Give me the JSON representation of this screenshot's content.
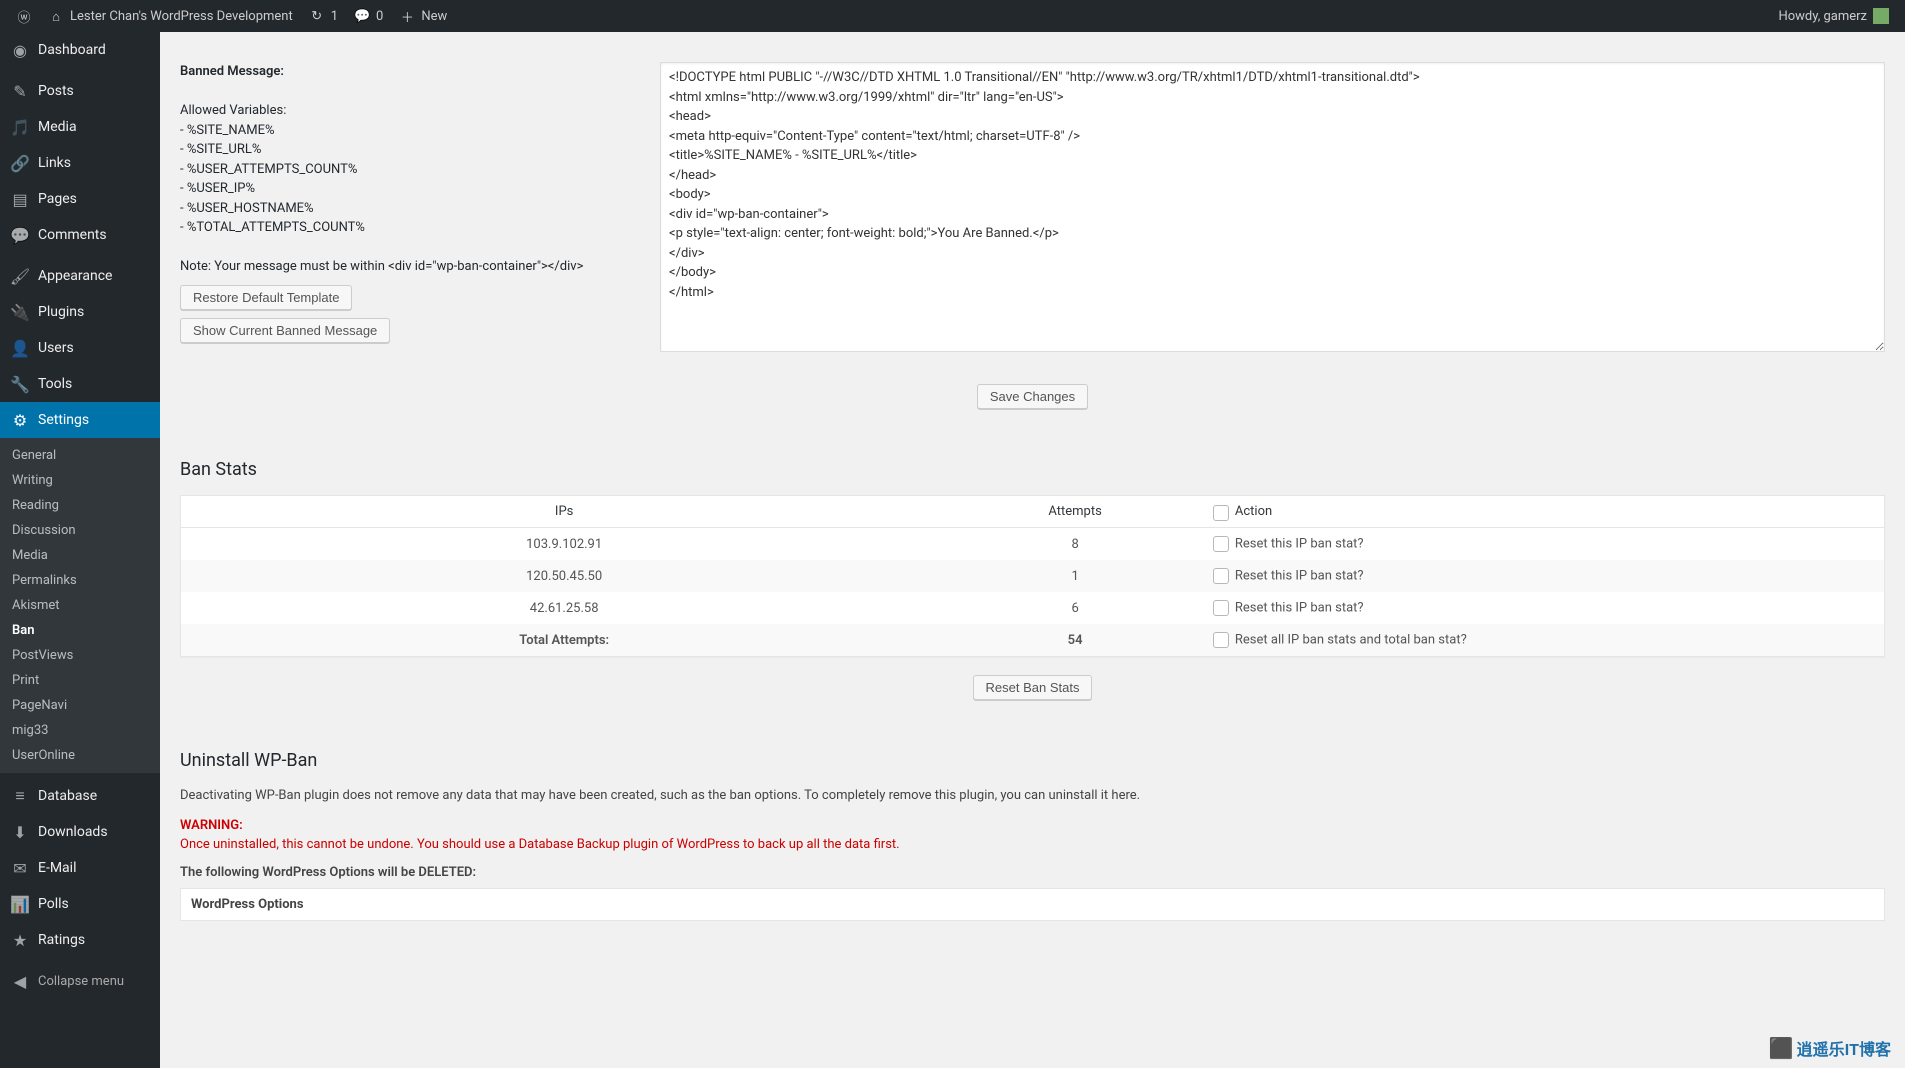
{
  "adminbar": {
    "site_name": "Lester Chan's WordPress Development",
    "updates_count": "1",
    "comments_count": "0",
    "new_label": "New",
    "howdy": "Howdy, gamerz"
  },
  "menu": {
    "dashboard": "Dashboard",
    "posts": "Posts",
    "media": "Media",
    "links": "Links",
    "pages": "Pages",
    "comments": "Comments",
    "appearance": "Appearance",
    "plugins": "Plugins",
    "users": "Users",
    "tools": "Tools",
    "settings": "Settings",
    "database": "Database",
    "downloads": "Downloads",
    "email": "E-Mail",
    "polls": "Polls",
    "ratings": "Ratings",
    "collapse": "Collapse menu"
  },
  "submenu": {
    "general": "General",
    "writing": "Writing",
    "reading": "Reading",
    "discussion": "Discussion",
    "media": "Media",
    "permalinks": "Permalinks",
    "akismet": "Akismet",
    "ban": "Ban",
    "postviews": "PostViews",
    "print": "Print",
    "pagenavi": "PageNavi",
    "mig33": "mig33",
    "useronline": "UserOnline"
  },
  "banned_message": {
    "label": "Banned Message:",
    "allowed_heading": "Allowed Variables:",
    "vars": [
      "- %SITE_NAME%",
      "- %SITE_URL%",
      "- %USER_ATTEMPTS_COUNT%",
      "- %USER_IP%",
      "- %USER_HOSTNAME%",
      "- %TOTAL_ATTEMPTS_COUNT%"
    ],
    "note": "Note: Your message must be within <div id=\"wp-ban-container\"></div>",
    "restore_btn": "Restore Default Template",
    "show_btn": "Show Current Banned Message",
    "textarea": "<!DOCTYPE html PUBLIC \"-//W3C//DTD XHTML 1.0 Transitional//EN\" \"http://www.w3.org/TR/xhtml1/DTD/xhtml1-transitional.dtd\">\n<html xmlns=\"http://www.w3.org/1999/xhtml\" dir=\"ltr\" lang=\"en-US\">\n<head>\n<meta http-equiv=\"Content-Type\" content=\"text/html; charset=UTF-8\" />\n<title>%SITE_NAME% - %SITE_URL%</title>\n</head>\n<body>\n<div id=\"wp-ban-container\">\n<p style=\"text-align: center; font-weight: bold;\">You Are Banned.</p>\n</div>\n</body>\n</html>"
  },
  "save_changes": "Save Changes",
  "ban_stats": {
    "heading": "Ban Stats",
    "cols": {
      "ips": "IPs",
      "attempts": "Attempts",
      "action": "Action"
    },
    "rows": [
      {
        "ip": "103.9.102.91",
        "attempts": "8",
        "action": "Reset this IP ban stat?"
      },
      {
        "ip": "120.50.45.50",
        "attempts": "1",
        "action": "Reset this IP ban stat?"
      },
      {
        "ip": "42.61.25.58",
        "attempts": "6",
        "action": "Reset this IP ban stat?"
      }
    ],
    "total_label": "Total Attempts:",
    "total_value": "54",
    "total_action": "Reset all IP ban stats and total ban stat?",
    "reset_btn": "Reset Ban Stats"
  },
  "uninstall": {
    "heading": "Uninstall WP-Ban",
    "desc": "Deactivating WP-Ban plugin does not remove any data that may have been created, such as the ban options. To completely remove this plugin, you can uninstall it here.",
    "warning_label": "WARNING:",
    "warning_text": "Once uninstalled, this cannot be undone. You should use a Database Backup plugin of WordPress to back up all the data first.",
    "deleted_heading": "The following WordPress Options will be DELETED:",
    "table_header": "WordPress Options"
  },
  "watermark": "逍遥乐IT博客"
}
